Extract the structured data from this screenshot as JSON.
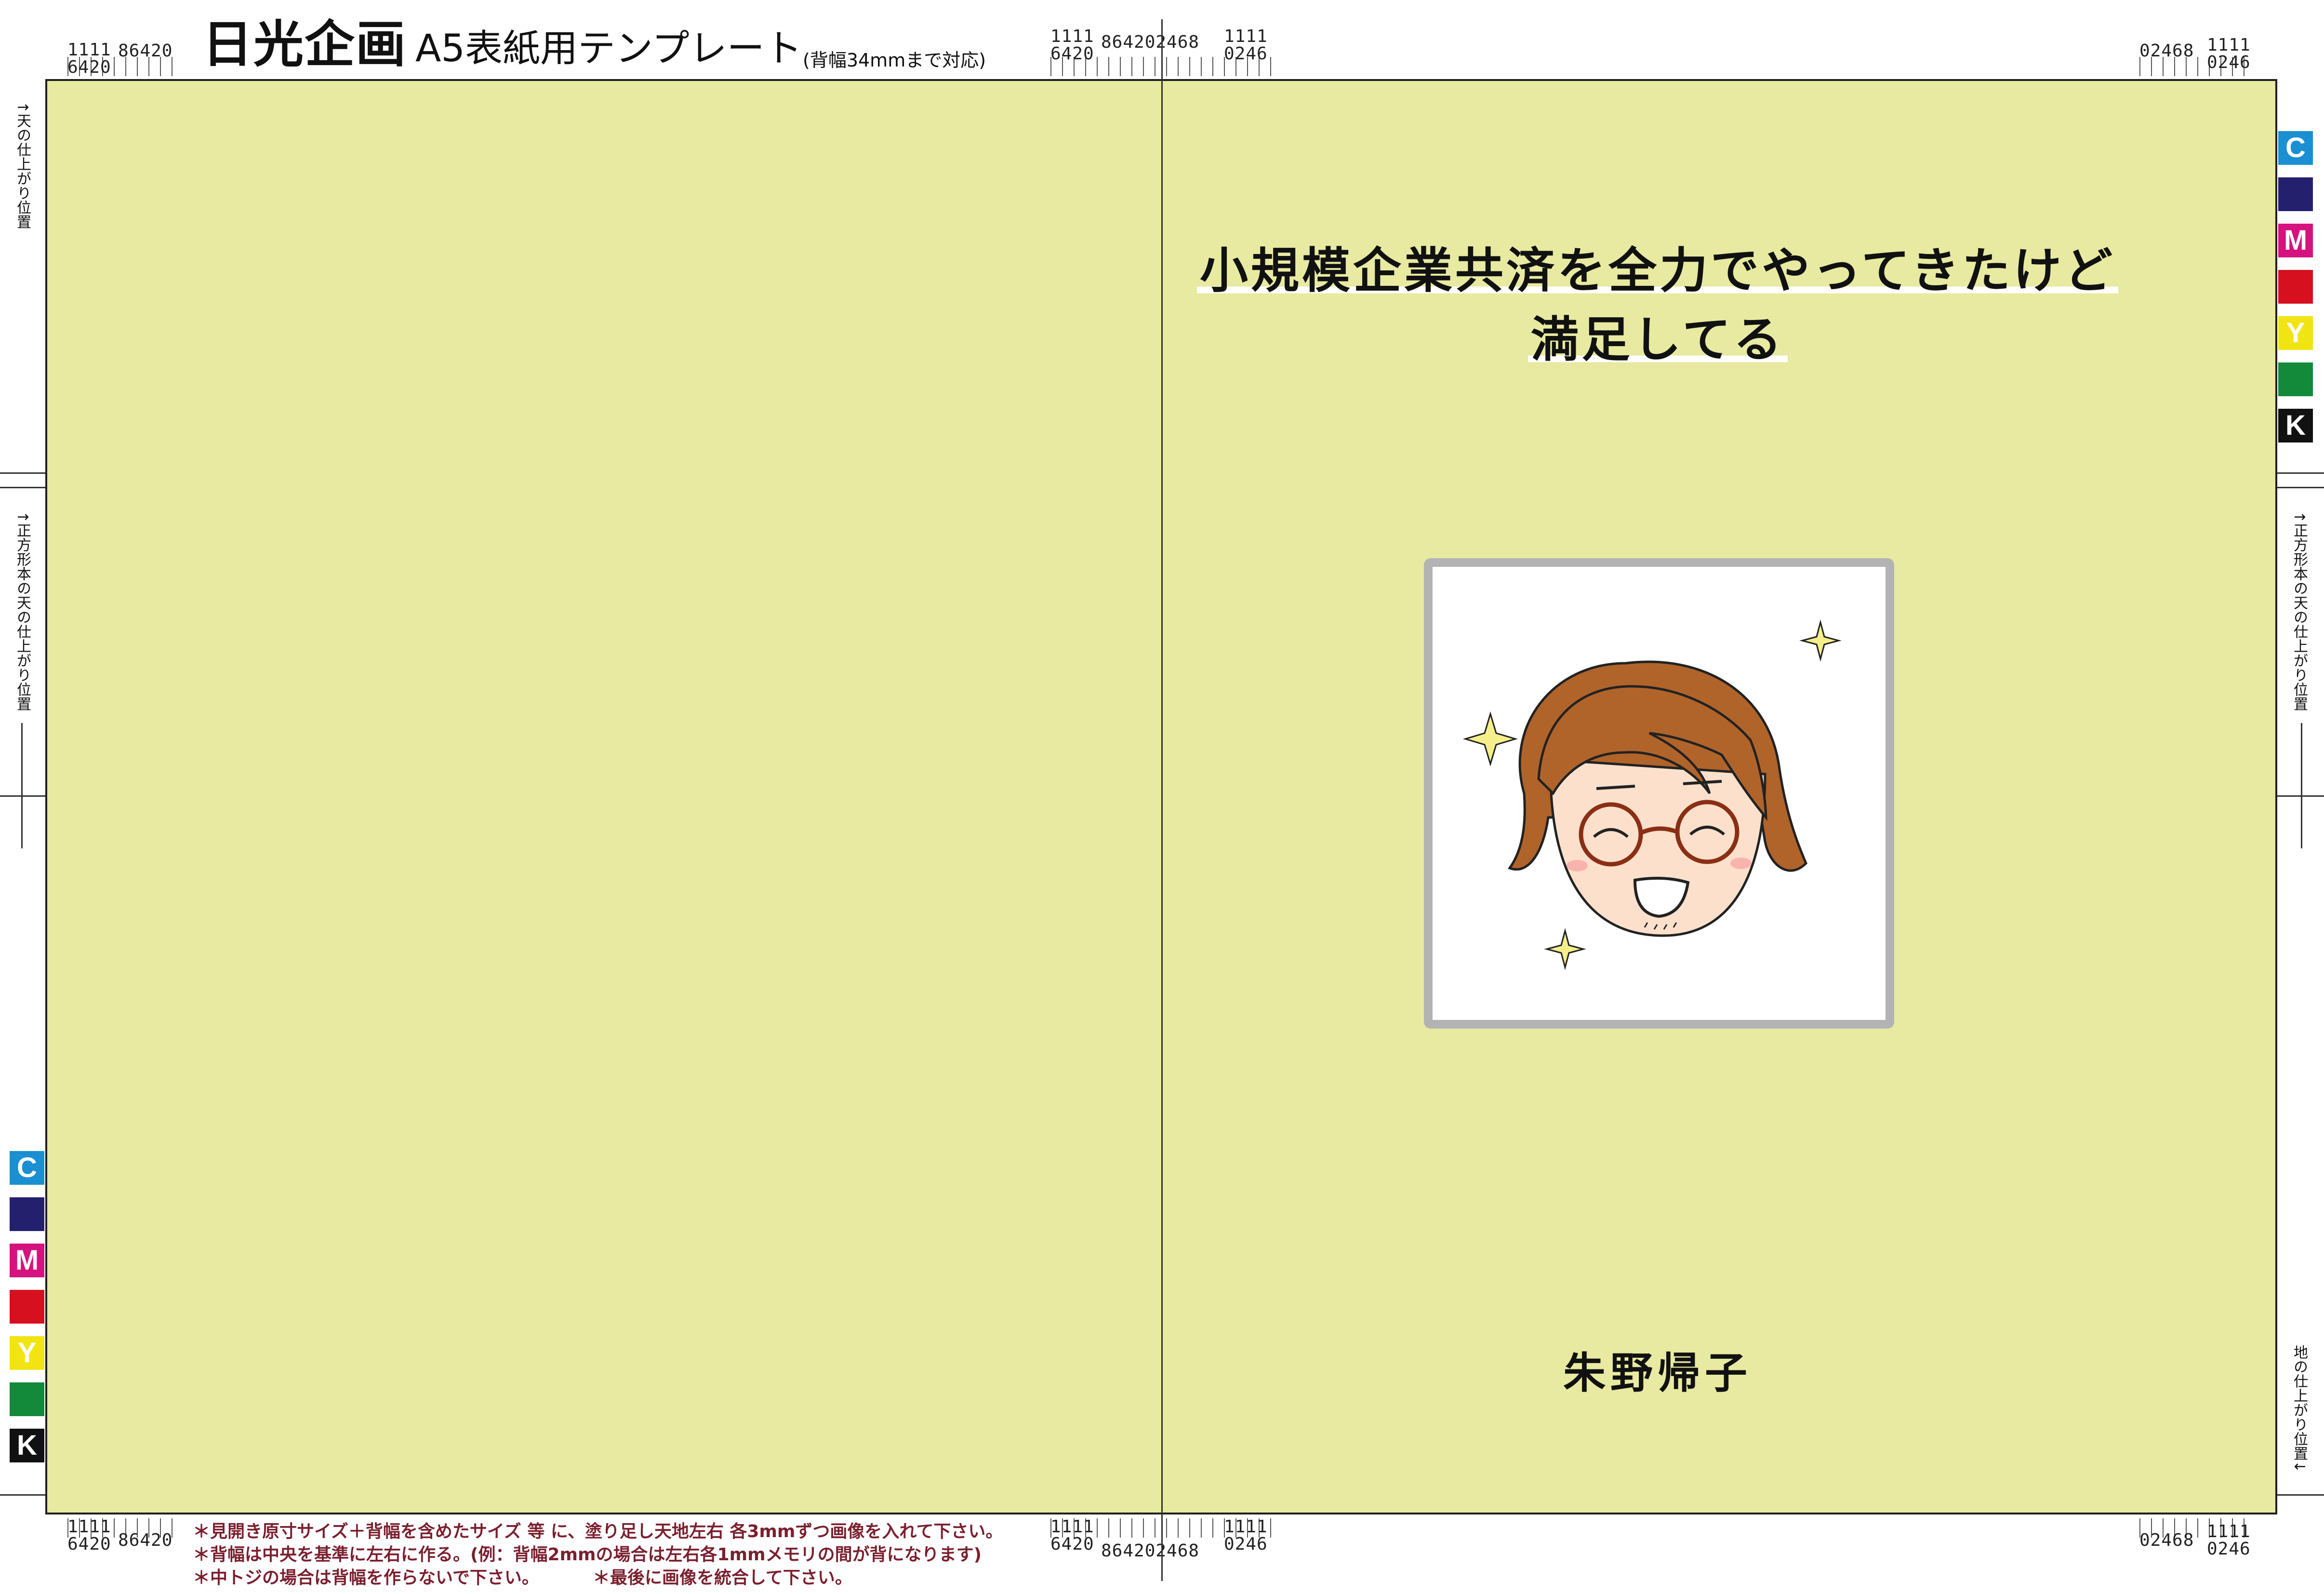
{
  "header": {
    "brand": "日光企画",
    "template_title": "A5表紙用テンプレート",
    "spine_note": "(背幅34mmまで対応)"
  },
  "rulers": {
    "left_top": "1111\n6420",
    "left_mid": "86420",
    "center_top_a": "1111\n6420",
    "center_mid": "864202468",
    "center_top_b": "1111\n0246",
    "right_mid": "02468",
    "right_top": "1111\n0246"
  },
  "crop_labels": {
    "top_left": "↑天の仕上がり位置",
    "square_left": "↑正方形本の天の仕上がり位置",
    "square_right": "↑正方形本の天の仕上がり位置",
    "bottom_right": "地の仕上がり位置↓"
  },
  "color_bars": [
    {
      "label": "C",
      "color": "#1a8fd1"
    },
    {
      "label": "",
      "color": "#25206e"
    },
    {
      "label": "M",
      "color": "#d6127e"
    },
    {
      "label": "",
      "color": "#d7101f"
    },
    {
      "label": "Y",
      "color": "#f2e413"
    },
    {
      "label": "",
      "color": "#138a3a"
    },
    {
      "label": "K",
      "color": "#111111"
    }
  ],
  "cover": {
    "background": "#e7eaa0",
    "title_line1": "小規模企業共済を全力でやってきたけど",
    "title_line2": "満足してる",
    "author": "朱野帰子",
    "portrait_icon": "smiling-person-with-glasses-icon"
  },
  "footer_notes": [
    "＊見開き原寸サイズ＋背幅を含めたサイズ 等 に、塗り足し天地左右 各3mmずつ画像を入れて下さい。",
    "＊背幅は中央を基準に左右に作る。(例：背幅2mmの場合は左右各1mmメモリの間が背になります)",
    "＊中トジの場合は背幅を作らないで下さい。",
    "＊最後に画像を統合して下さい。"
  ]
}
